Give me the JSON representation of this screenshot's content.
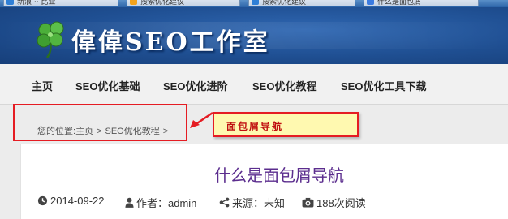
{
  "browser_tabs": [
    {
      "label": "新浪 ·· 比亚",
      "color": "#2f7fd6"
    },
    {
      "label": "搜索优化建议",
      "color": "#f2a21c"
    },
    {
      "label": "搜索优化建议",
      "color": "#2f7fd6"
    },
    {
      "label": "什么是面包屑",
      "color": "#3b7be0"
    }
  ],
  "site": {
    "title": "偉偉SEO工作室",
    "logo_icon": "clover-logo-icon"
  },
  "nav": {
    "items": [
      "主页",
      "SEO优化基础",
      "SEO优化进阶",
      "SEO优化教程",
      "SEO优化工具下载"
    ]
  },
  "breadcrumb": {
    "prefix": "您的位置:",
    "home": "主页",
    "separator": ">",
    "category": "SEO优化教程",
    "trailing": ">"
  },
  "annotation": {
    "note": "面包屑导航",
    "box_color": "#e51c23",
    "note_bg": "#fff9b0"
  },
  "post": {
    "title": "什么是面包屑导航",
    "date": "2014-09-22",
    "author": "作者：admin",
    "source": "来源：未知",
    "views": "188次阅读",
    "title_color": "#5b2d8e"
  },
  "icons": {
    "date": "clock-icon",
    "author": "user-icon",
    "source": "share-icon",
    "views": "camera-icon"
  }
}
